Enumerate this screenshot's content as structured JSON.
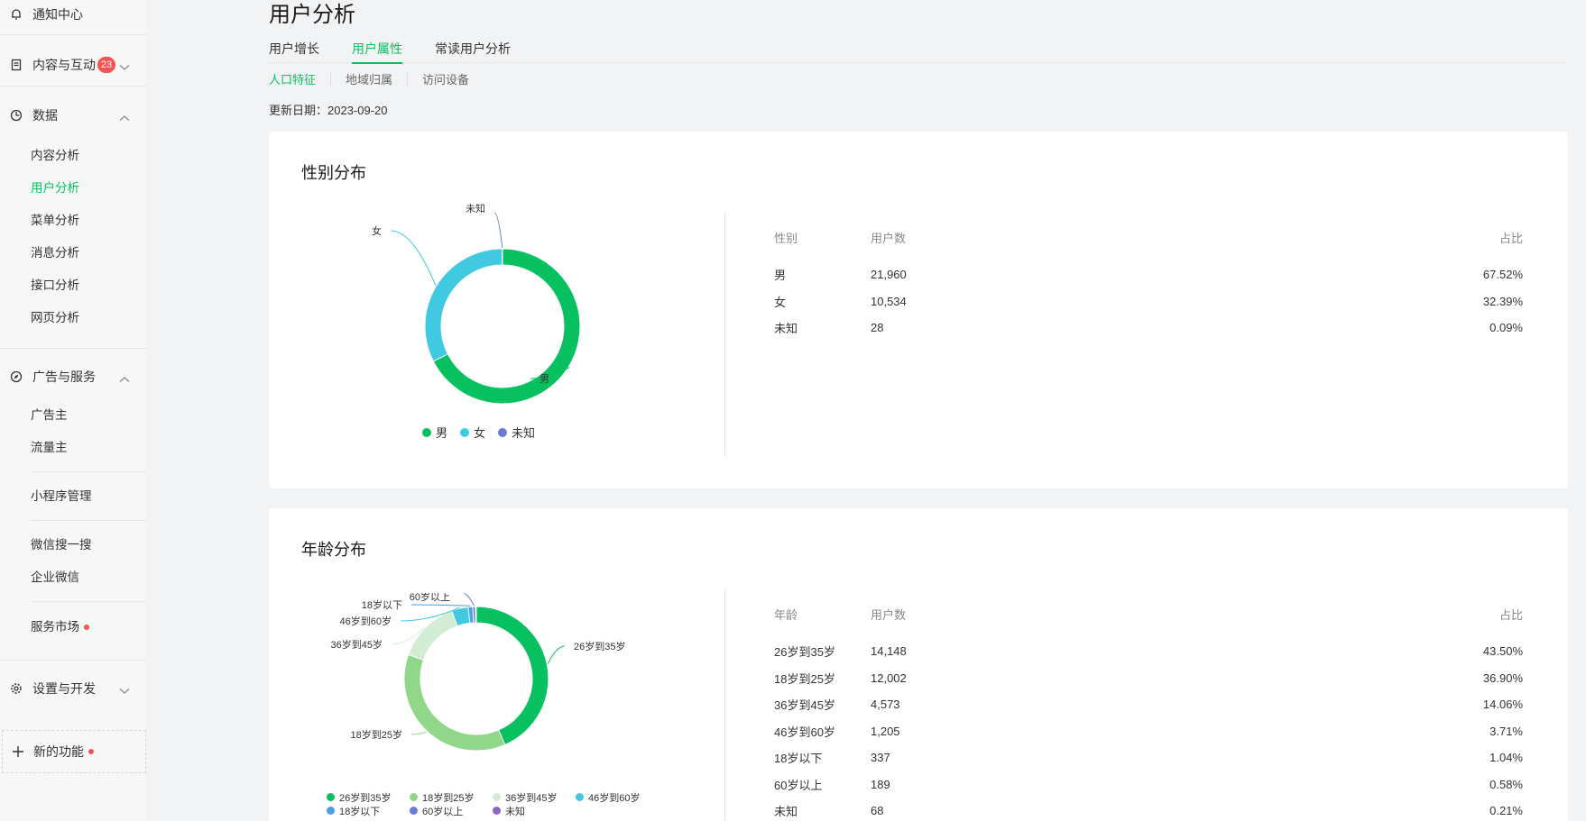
{
  "sidebar": {
    "notifications": "通知中心",
    "content": "内容与互动",
    "content_badge": "23",
    "data": "数据",
    "data_items": [
      "内容分析",
      "用户分析",
      "菜单分析",
      "消息分析",
      "接口分析",
      "网页分析"
    ],
    "ads": "广告与服务",
    "ads_items": [
      "广告主",
      "流量主"
    ],
    "miniprogram": "小程序管理",
    "search": "微信搜一搜",
    "work_wechat": "企业微信",
    "market": "服务市场",
    "settings": "设置与开发",
    "new_features": "新的功能"
  },
  "page": {
    "title": "用户分析",
    "tabs": [
      "用户增长",
      "用户属性",
      "常读用户分析"
    ],
    "subtabs": [
      "人口特征",
      "地域归属",
      "访问设备"
    ],
    "update_label": "更新日期：",
    "update_date": "2023-09-20"
  },
  "gender": {
    "title": "性别分布",
    "headers": [
      "性别",
      "用户数",
      "占比"
    ],
    "rows": [
      {
        "label": "男",
        "count": "21,960",
        "pct": "67.52%"
      },
      {
        "label": "女",
        "count": "10,534",
        "pct": "32.39%"
      },
      {
        "label": "未知",
        "count": "28",
        "pct": "0.09%"
      }
    ]
  },
  "age": {
    "title": "年龄分布",
    "headers": [
      "年龄",
      "用户数",
      "占比"
    ],
    "rows": [
      {
        "label": "26岁到35岁",
        "count": "14,148",
        "pct": "43.50%"
      },
      {
        "label": "18岁到25岁",
        "count": "12,002",
        "pct": "36.90%"
      },
      {
        "label": "36岁到45岁",
        "count": "4,573",
        "pct": "14.06%"
      },
      {
        "label": "46岁到60岁",
        "count": "1,205",
        "pct": "3.71%"
      },
      {
        "label": "18岁以下",
        "count": "337",
        "pct": "1.04%"
      },
      {
        "label": "60岁以上",
        "count": "189",
        "pct": "0.58%"
      },
      {
        "label": "未知",
        "count": "68",
        "pct": "0.21%"
      }
    ]
  },
  "chart_data": [
    {
      "type": "pie",
      "title": "性别分布",
      "categories": [
        "男",
        "女",
        "未知"
      ],
      "values": [
        21960,
        10534,
        28
      ],
      "colors": [
        "#07c160",
        "#40c9e0",
        "#6a7bd6"
      ],
      "legend": "bottom"
    },
    {
      "type": "pie",
      "title": "年龄分布",
      "categories": [
        "26岁到35岁",
        "18岁到25岁",
        "36岁到45岁",
        "46岁到60岁",
        "18岁以下",
        "60岁以上",
        "未知"
      ],
      "values": [
        14148,
        12002,
        4573,
        1205,
        337,
        189,
        68
      ],
      "colors": [
        "#07c160",
        "#91d78a",
        "#d2edd3",
        "#40c9e0",
        "#4a9fe8",
        "#6a7bd6",
        "#8e64c9"
      ],
      "legend": "bottom"
    }
  ]
}
